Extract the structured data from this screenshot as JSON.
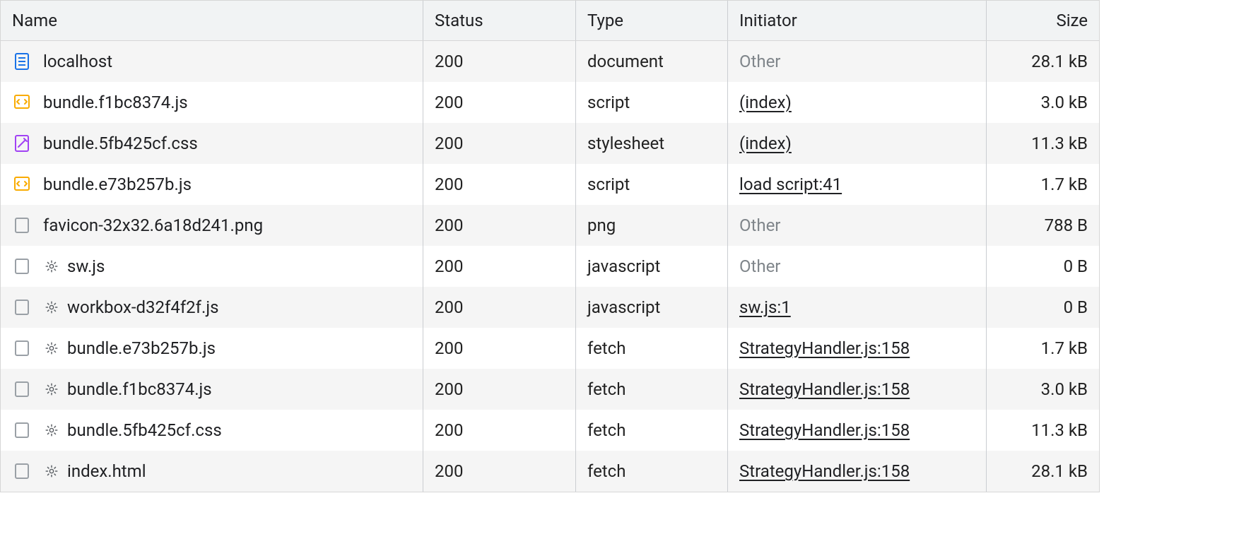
{
  "columns": {
    "name": "Name",
    "status": "Status",
    "type": "Type",
    "initiator": "Initiator",
    "size": "Size"
  },
  "rows": [
    {
      "icon": "document",
      "gear": false,
      "name": "localhost",
      "status": "200",
      "type": "document",
      "initiator": "Other",
      "initiatorLink": false,
      "size": "28.1 kB"
    },
    {
      "icon": "script",
      "gear": false,
      "name": "bundle.f1bc8374.js",
      "status": "200",
      "type": "script",
      "initiator": "(index)",
      "initiatorLink": true,
      "size": "3.0 kB"
    },
    {
      "icon": "stylesheet",
      "gear": false,
      "name": "bundle.5fb425cf.css",
      "status": "200",
      "type": "stylesheet",
      "initiator": "(index)",
      "initiatorLink": true,
      "size": "11.3 kB"
    },
    {
      "icon": "script",
      "gear": false,
      "name": "bundle.e73b257b.js",
      "status": "200",
      "type": "script",
      "initiator": "load script:41",
      "initiatorLink": true,
      "size": "1.7 kB"
    },
    {
      "icon": "generic",
      "gear": false,
      "name": "favicon-32x32.6a18d241.png",
      "status": "200",
      "type": "png",
      "initiator": "Other",
      "initiatorLink": false,
      "size": "788 B"
    },
    {
      "icon": "generic",
      "gear": true,
      "name": "sw.js",
      "status": "200",
      "type": "javascript",
      "initiator": "Other",
      "initiatorLink": false,
      "size": "0 B"
    },
    {
      "icon": "generic",
      "gear": true,
      "name": "workbox-d32f4f2f.js",
      "status": "200",
      "type": "javascript",
      "initiator": "sw.js:1",
      "initiatorLink": true,
      "size": "0 B"
    },
    {
      "icon": "generic",
      "gear": true,
      "name": "bundle.e73b257b.js",
      "status": "200",
      "type": "fetch",
      "initiator": "StrategyHandler.js:158",
      "initiatorLink": true,
      "size": "1.7 kB"
    },
    {
      "icon": "generic",
      "gear": true,
      "name": "bundle.f1bc8374.js",
      "status": "200",
      "type": "fetch",
      "initiator": "StrategyHandler.js:158",
      "initiatorLink": true,
      "size": "3.0 kB"
    },
    {
      "icon": "generic",
      "gear": true,
      "name": "bundle.5fb425cf.css",
      "status": "200",
      "type": "fetch",
      "initiator": "StrategyHandler.js:158",
      "initiatorLink": true,
      "size": "11.3 kB"
    },
    {
      "icon": "generic",
      "gear": true,
      "name": "index.html",
      "status": "200",
      "type": "fetch",
      "initiator": "StrategyHandler.js:158",
      "initiatorLink": true,
      "size": "28.1 kB"
    }
  ]
}
